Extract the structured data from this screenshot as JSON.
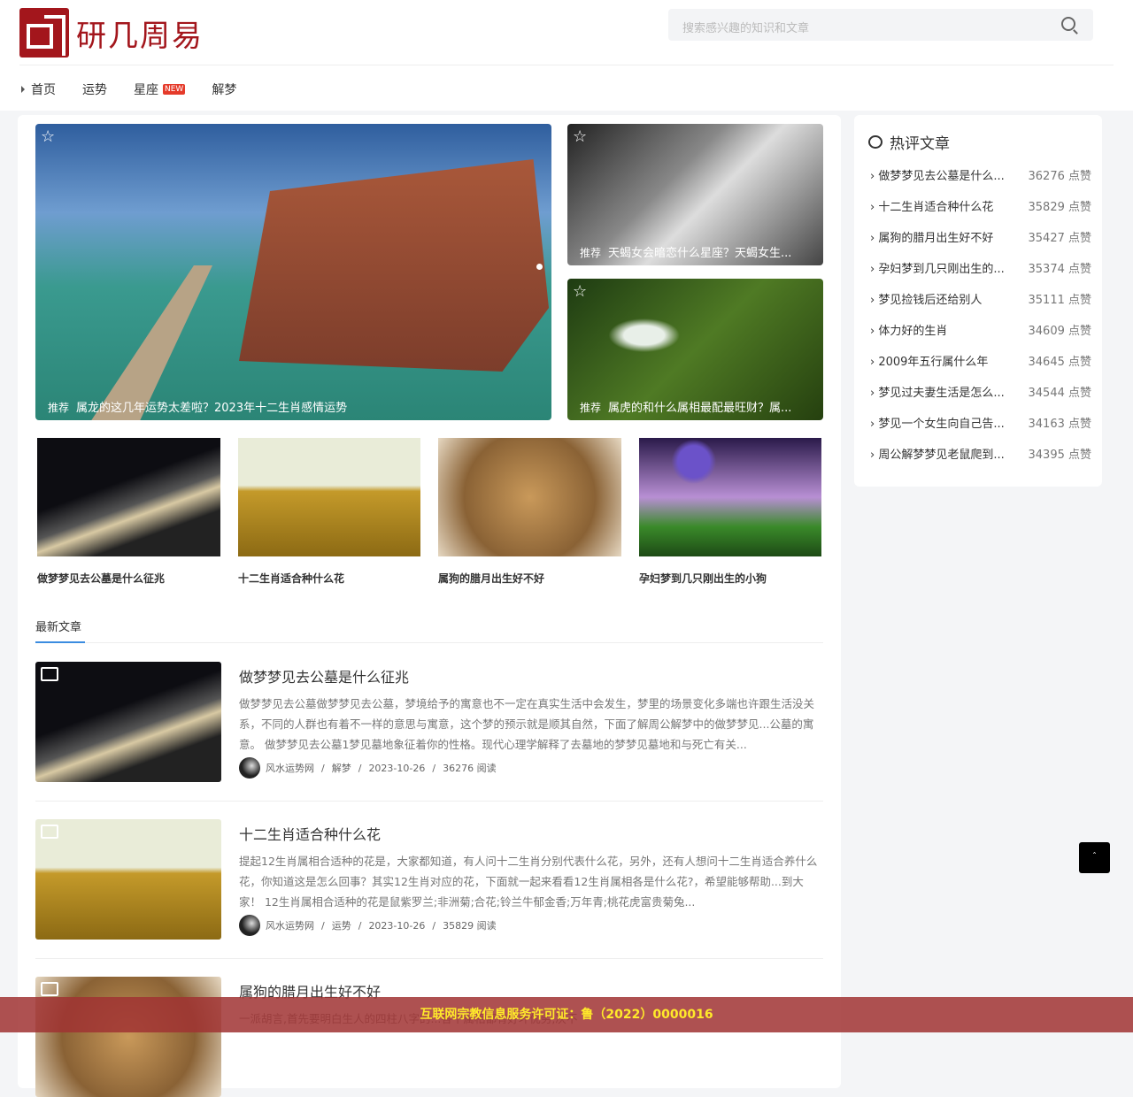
{
  "site": {
    "name": "研几周易",
    "search_placeholder": "搜索感兴趣的知识和文章"
  },
  "nav": [
    {
      "label": "首页"
    },
    {
      "label": "运势"
    },
    {
      "label": "星座",
      "badge": "NEW"
    },
    {
      "label": "解梦"
    }
  ],
  "slider": {
    "tag": "推荐",
    "main": "属龙的这几年运势太差啦？2023年十二生肖感情运势",
    "side1": "天蝎女会暗恋什么星座？天蝎女生...",
    "side2": "属虎的和什么属相最配最旺财？属..."
  },
  "thumbs": [
    "做梦梦见去公墓是什么征兆",
    "十二生肖适合种什么花",
    "属狗的腊月出生好不好",
    "孕妇梦到几只刚出生的小狗"
  ],
  "latest": {
    "title": "最新文章",
    "articles": [
      {
        "title": "做梦梦见去公墓是什么征兆",
        "excerpt": "做梦梦见去公墓做梦梦见去公墓，梦境给予的寓意也不一定在真实生活中会发生，梦里的场景变化多端也许跟生活没关系，不同的人群也有着不一样的意思与寓意，这个梦的预示就是顺其自然，下面了解周公解梦中的做梦梦见...公墓的寓意。 做梦梦见去公墓1梦见墓地象征着你的性格。现代心理学解释了去墓地的梦梦见墓地和与死亡有关...",
        "author": "风水运势网",
        "category": "解梦",
        "date": "2023-10-26",
        "reads": "36276 阅读"
      },
      {
        "title": "十二生肖适合种什么花",
        "excerpt": "提起12生肖属相合适种的花是，大家都知道，有人问十二生肖分别代表什么花，另外，还有人想问十二生肖适合养什么花，你知道这是怎么回事？其实12生肖对应的花，下面就一起来看看12生肖属相各是什么花?，希望能够帮助...到大家！ 12生肖属相合适种的花是鼠紫罗兰;非洲菊;合花;铃兰牛郁金香;万年青;桃花虎富贵菊兔...",
        "author": "风水运势网",
        "category": "运势",
        "date": "2023-10-26",
        "reads": "35829 阅读"
      },
      {
        "title": "属狗的腊月出生好不好",
        "excerpt": "一派胡言,首先要明白生人的四柱八字的...各个属相都有好坏优劣,决不"
      }
    ]
  },
  "hot": {
    "title": "热评文章",
    "items": [
      {
        "t": "做梦梦见去公墓是什么...",
        "n": "36276 点赞"
      },
      {
        "t": "十二生肖适合种什么花",
        "n": "35829 点赞"
      },
      {
        "t": "属狗的腊月出生好不好",
        "n": "35427 点赞"
      },
      {
        "t": "孕妇梦到几只刚出生的...",
        "n": "35374 点赞"
      },
      {
        "t": "梦见捡钱后还给别人",
        "n": "35111 点赞"
      },
      {
        "t": "体力好的生肖",
        "n": "34609 点赞"
      },
      {
        "t": "2009年五行属什么年",
        "n": "34645 点赞"
      },
      {
        "t": "梦见过夫妻生活是怎么...",
        "n": "34544 点赞"
      },
      {
        "t": "梦见一个女生向自己告...",
        "n": "34163 点赞"
      },
      {
        "t": "周公解梦梦见老鼠爬到...",
        "n": "34395 点赞"
      }
    ]
  },
  "footer": "互联网宗教信息服务许可证：鲁（2022）0000016",
  "top_button": "ˆ"
}
